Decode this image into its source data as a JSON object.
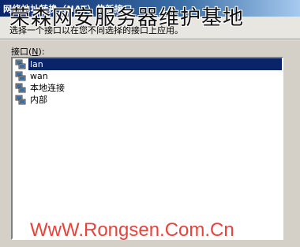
{
  "window": {
    "title": "网络地址转换（NAT）的新接口",
    "subtitle": "选择一个接口以在您不同选择的接口上应用。"
  },
  "interface_list": {
    "label": "接口(N):",
    "label_text": "接口(",
    "label_hotkey": "N",
    "label_suffix": "):",
    "items": [
      {
        "label": "lan",
        "icon": "network-adapter-icon",
        "selected": true
      },
      {
        "label": "wan",
        "icon": "network-adapter-icon",
        "selected": false
      },
      {
        "label": "本地连接",
        "icon": "network-adapter-icon",
        "selected": false
      },
      {
        "label": "内部",
        "icon": "network-adapter-icon",
        "selected": false
      }
    ]
  },
  "watermarks": {
    "top": "荣森网安服务器维护基地",
    "bottom": "WwW.Rongsen.Com.Cn"
  },
  "colors": {
    "selection": "#0a246a",
    "dialog_bg": "#d4d0c8",
    "watermark_bottom": "#e8433a"
  }
}
